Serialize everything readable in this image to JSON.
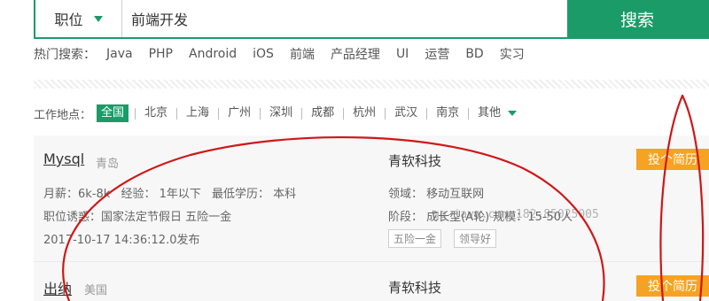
{
  "search": {
    "category": "职位",
    "query": "前端开发",
    "button": "搜索"
  },
  "hot": {
    "label": "热门搜索：",
    "items": [
      "Java",
      "PHP",
      "Android",
      "iOS",
      "前端",
      "产品经理",
      "UI",
      "运营",
      "BD",
      "实习"
    ]
  },
  "location": {
    "label": "工作地点：",
    "items": [
      "全国",
      "北京",
      "上海",
      "广州",
      "深圳",
      "成都",
      "杭州",
      "武汉",
      "南京"
    ],
    "active": "全国",
    "more": "其他"
  },
  "jobs": [
    {
      "title": "Mysql",
      "city": "青岛",
      "salary": "月薪：6k-8k",
      "experience": "经验： 1年以下",
      "education": "最低学历： 本科",
      "benefits": "职位诱惑：国家法定节假日 五险一金",
      "posted": "2017-10-17 14:36:12.0发布",
      "company": "青软科技",
      "field": "领域： 移动互联网",
      "stage": "阶段： 成长型(A轮) 规模：15-50人",
      "tags": [
        "五险一金",
        "领导好"
      ],
      "apply": "投个简历"
    },
    {
      "title": "出纳",
      "city": "美国",
      "company": "青软科技",
      "apply": "投个简历"
    }
  ],
  "watermark": "qq-java.com 182-85025005",
  "colors": {
    "accent": "#1b9b68",
    "apply": "#f6a323",
    "annotation": "#d01717"
  }
}
